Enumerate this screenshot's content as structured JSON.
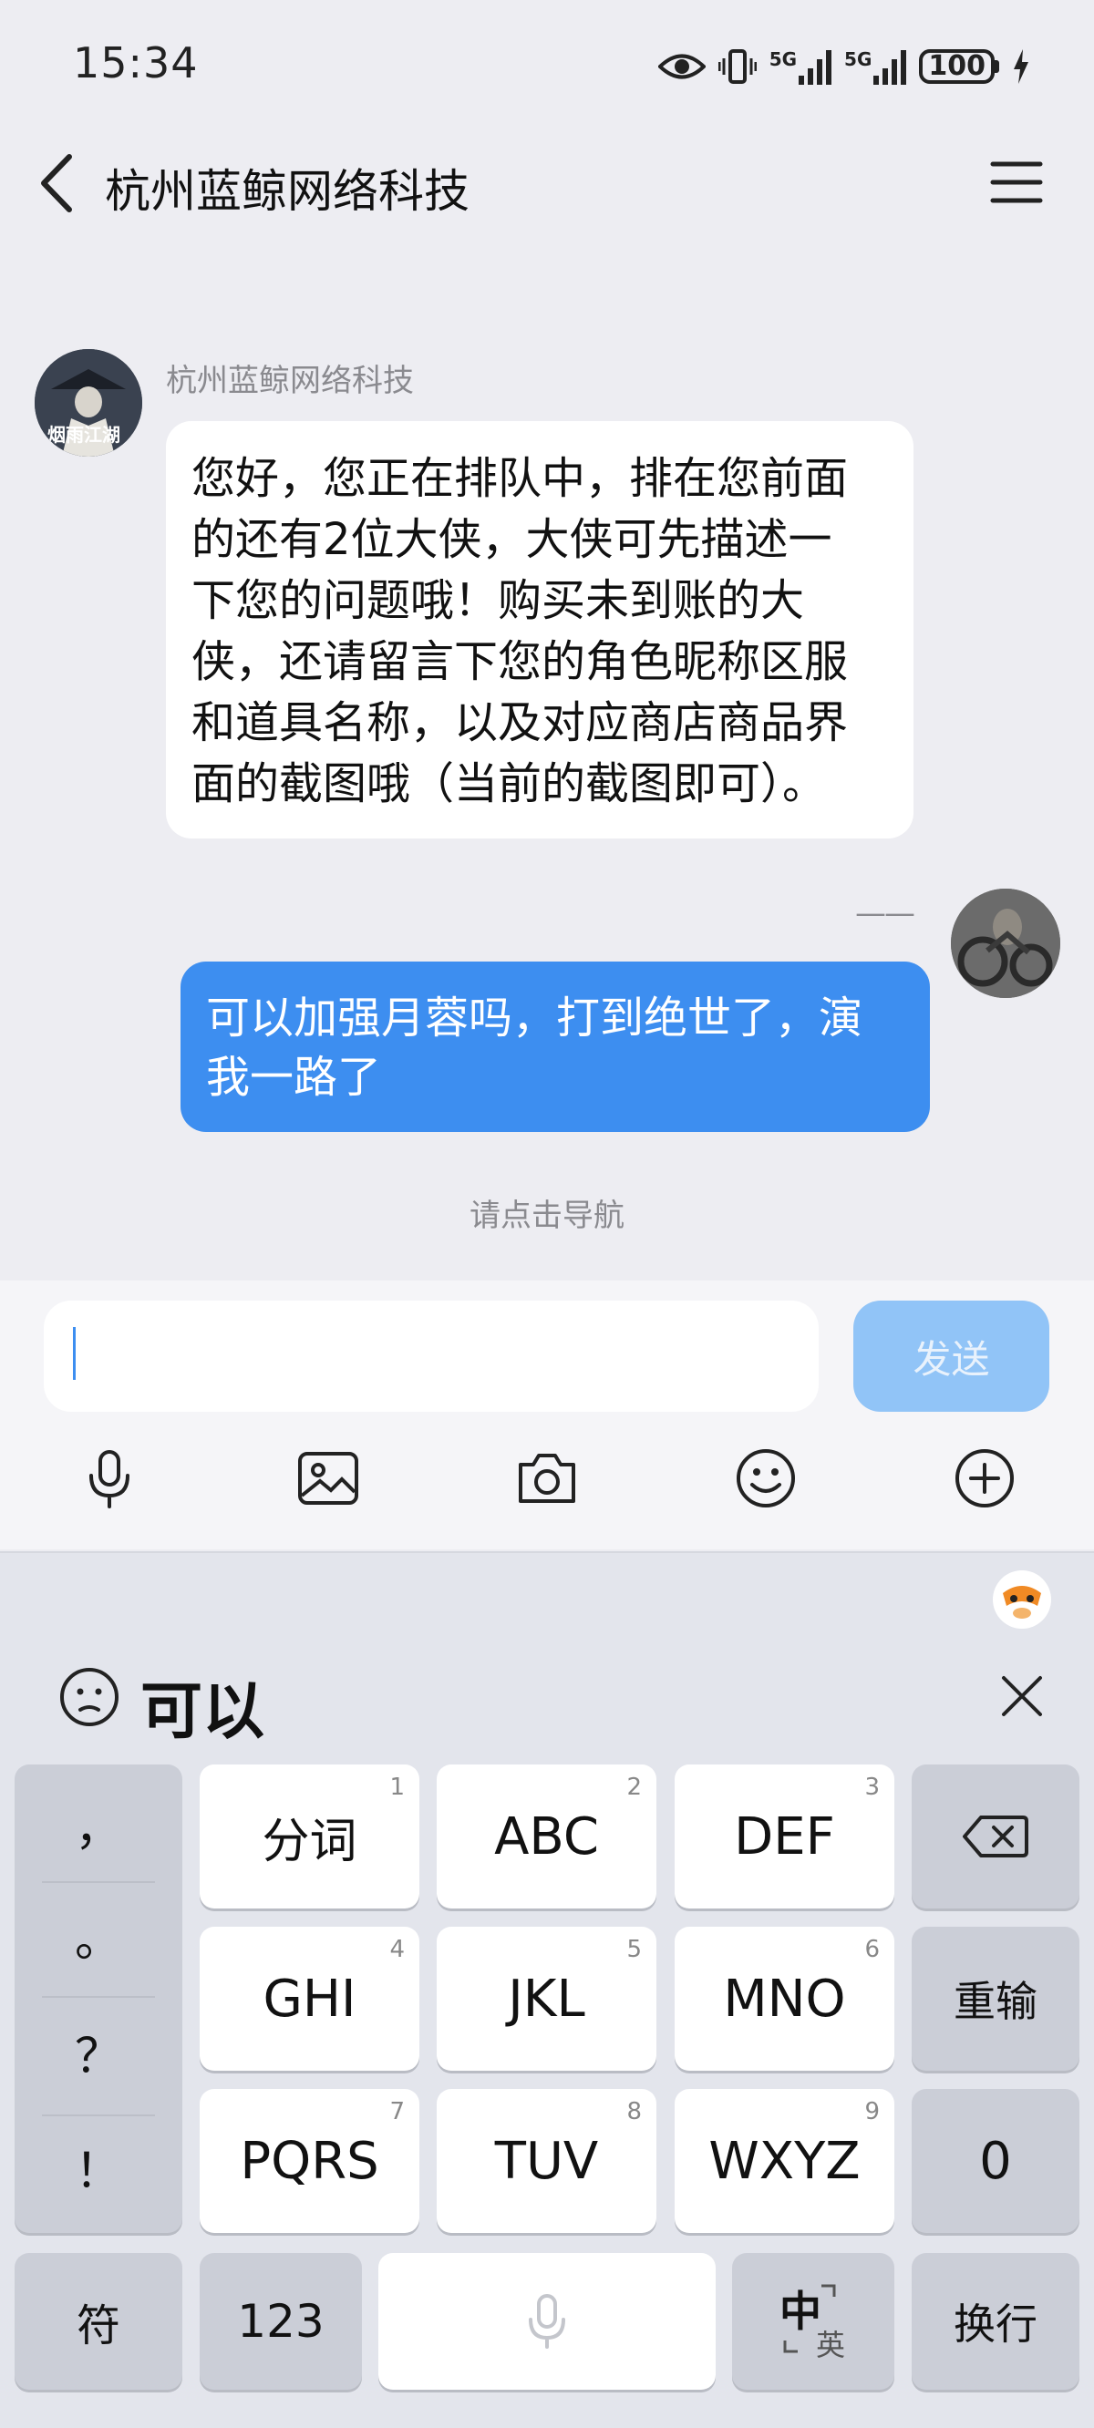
{
  "status_bar": {
    "time": "15:34",
    "network_1": "5G",
    "network_2": "5G",
    "battery": "100",
    "icons": [
      "eye-icon",
      "vibrate-icon",
      "signal-icon",
      "signal-icon",
      "battery-icon",
      "charging-icon"
    ]
  },
  "header": {
    "title": "杭州蓝鲸网络科技"
  },
  "messages": {
    "incoming": {
      "sender": "杭州蓝鲸网络科技",
      "avatar_text": "烟雨江湖",
      "lines": [
        "您好，您正在排队中，排在您前面",
        "的还有2位大侠，大侠可先描述一",
        "下您的问题哦！购买未到账的大",
        "侠，还请留言下您的角色昵称区服",
        "和道具名称，以及对应商店商品界",
        "面的截图哦（当前的截图即可）。"
      ]
    },
    "outgoing": {
      "sender": "——",
      "lines": [
        "可以加强月蓉吗，打到绝世了，演",
        "我一路了"
      ]
    },
    "nav_hint": "请点击导航"
  },
  "composer": {
    "input_value": "",
    "send_label": "发送",
    "tools": [
      "microphone-icon",
      "image-icon",
      "camera-icon",
      "emoji-icon",
      "plus-icon"
    ]
  },
  "keyboard": {
    "candidate": "可以",
    "punctuation": [
      "，",
      "。",
      "？",
      "！"
    ],
    "rows": [
      [
        {
          "label": "分词",
          "num": "1"
        },
        {
          "label": "ABC",
          "num": "2"
        },
        {
          "label": "DEF",
          "num": "3"
        }
      ],
      [
        {
          "label": "GHI",
          "num": "4"
        },
        {
          "label": "JKL",
          "num": "5"
        },
        {
          "label": "MNO",
          "num": "6"
        }
      ],
      [
        {
          "label": "PQRS",
          "num": "7"
        },
        {
          "label": "TUV",
          "num": "8"
        },
        {
          "label": "WXYZ",
          "num": "9"
        }
      ]
    ],
    "retype_label": "重输",
    "zero_label": "0",
    "symbols_label": "符",
    "numbers_label": "123",
    "cn_label": "中",
    "en_label": "英",
    "enter_label": "换行"
  },
  "colors": {
    "accent": "#3d8ef0",
    "send_disabled": "#91c4f7",
    "background": "#ededf2"
  }
}
